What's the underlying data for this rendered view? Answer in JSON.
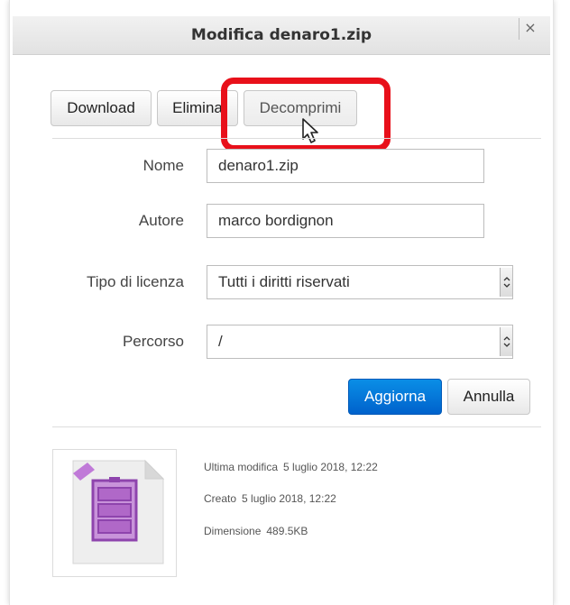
{
  "dialog": {
    "title": "Modifica denaro1.zip",
    "close_label": "×"
  },
  "toolbar": {
    "download_label": "Download",
    "delete_label": "Elimina",
    "unzip_label": "Decomprimi"
  },
  "form": {
    "name_label": "Nome",
    "name_value": "denaro1.zip",
    "author_label": "Autore",
    "author_value": "marco bordignon",
    "license_label": "Tipo di licenza",
    "license_value": "Tutti i diritti riservati",
    "path_label": "Percorso",
    "path_value": "/"
  },
  "actions": {
    "update_label": "Aggiorna",
    "cancel_label": "Annulla"
  },
  "file_info": {
    "modified_label": "Ultima modifica",
    "modified_value": "5 luglio 2018, 12:22",
    "created_label": "Creato",
    "created_value": "5 luglio 2018, 12:22",
    "size_label": "Dimensione",
    "size_value": "489.5KB"
  },
  "icons": {
    "file": "zip-file-icon",
    "cursor": "mouse-cursor-icon",
    "dropdown": "dropdown-arrow-icon"
  },
  "colors": {
    "highlight": "#e8101a",
    "primary_button": "#0a7fdc",
    "zip_icon": "#b068c8"
  }
}
